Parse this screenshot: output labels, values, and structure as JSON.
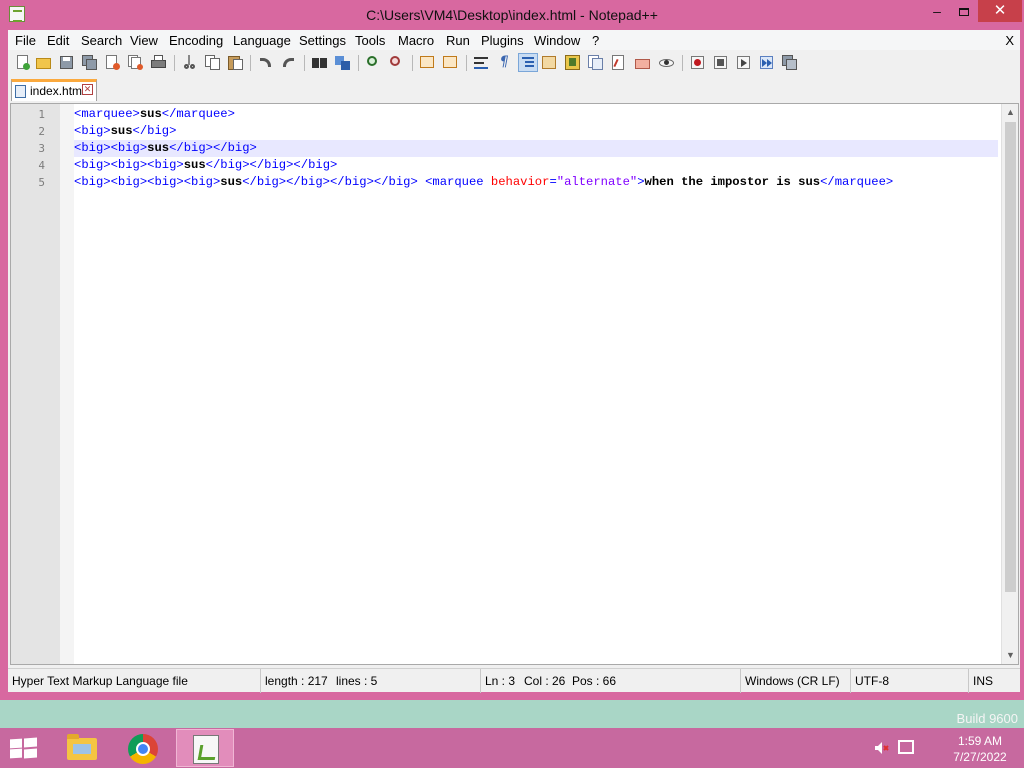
{
  "window": {
    "title": "C:\\Users\\VM4\\Desktop\\index.html - Notepad++",
    "minimize": "–",
    "close": "✕"
  },
  "menubar": {
    "items": [
      "File",
      "Edit",
      "Search",
      "View",
      "Encoding",
      "Language",
      "Settings",
      "Tools",
      "Macro",
      "Run",
      "Plugins",
      "Window",
      "?"
    ],
    "close_label": "X"
  },
  "toolbar": {
    "buttons": [
      "new",
      "open",
      "save",
      "save-all",
      "close",
      "close-all",
      "print",
      "cut",
      "copy",
      "paste",
      "undo",
      "redo",
      "find",
      "replace",
      "zoom-in",
      "zoom-out",
      "sync-vertical",
      "sync-horizontal",
      "word-wrap",
      "show-all-chars",
      "indent-guide",
      "user-defined-language",
      "doc-map",
      "function-list",
      "folder-as-workspace",
      "document-list",
      "monitoring",
      "record-macro",
      "stop-recording",
      "play-macro",
      "run-macro-multiple",
      "save-macro"
    ]
  },
  "tabs": [
    {
      "label": "index.html",
      "active": true
    }
  ],
  "editor": {
    "line_numbers": [
      "1",
      "2",
      "3",
      "4",
      "5"
    ],
    "current_line": 3,
    "lines": [
      [
        [
          "tag",
          "<marquee>"
        ],
        [
          "txt",
          "sus"
        ],
        [
          "tag",
          "</marquee>"
        ]
      ],
      [
        [
          "tag",
          "<big>"
        ],
        [
          "txt",
          "sus"
        ],
        [
          "tag",
          "</big>"
        ]
      ],
      [
        [
          "tag",
          "<big><big>"
        ],
        [
          "txt",
          "sus"
        ],
        [
          "tag",
          "</big></big>"
        ]
      ],
      [
        [
          "tag",
          "<big><big><big>"
        ],
        [
          "txt",
          "sus"
        ],
        [
          "tag",
          "</big></big></big>"
        ]
      ],
      [
        [
          "tag",
          "<big><big><big><big>"
        ],
        [
          "txt",
          "sus"
        ],
        [
          "tag",
          "</big></big></big></big>"
        ],
        [
          "txt",
          " "
        ],
        [
          "tag",
          "<marquee "
        ],
        [
          "attr",
          "behavior"
        ],
        [
          "tag",
          "="
        ],
        [
          "val",
          "\"alternate\""
        ],
        [
          "tag",
          ">"
        ],
        [
          "txt",
          "when the impostor is sus"
        ],
        [
          "tag",
          "</marquee>"
        ]
      ]
    ]
  },
  "statusbar": {
    "file_type": "Hyper Text Markup Language file",
    "length": "length : 217",
    "lines": "lines : 5",
    "ln": "Ln : 3",
    "col": "Col : 26",
    "pos": "Pos : 66",
    "eol": "Windows (CR LF)",
    "encoding": "UTF-8",
    "mode": "INS"
  },
  "desktop": {
    "watermark": "Build 9600"
  },
  "taskbar": {
    "items": [
      "file-explorer",
      "chrome",
      "notepad-plus-plus"
    ],
    "time": "1:59 AM",
    "date": "7/27/2022"
  },
  "colors": {
    "frame": "#d868a0",
    "taskbar": "#c7699f",
    "tag": "#0000ff",
    "attribute": "#ff0000",
    "value": "#8000ff",
    "current_line": "#e8e8ff"
  }
}
